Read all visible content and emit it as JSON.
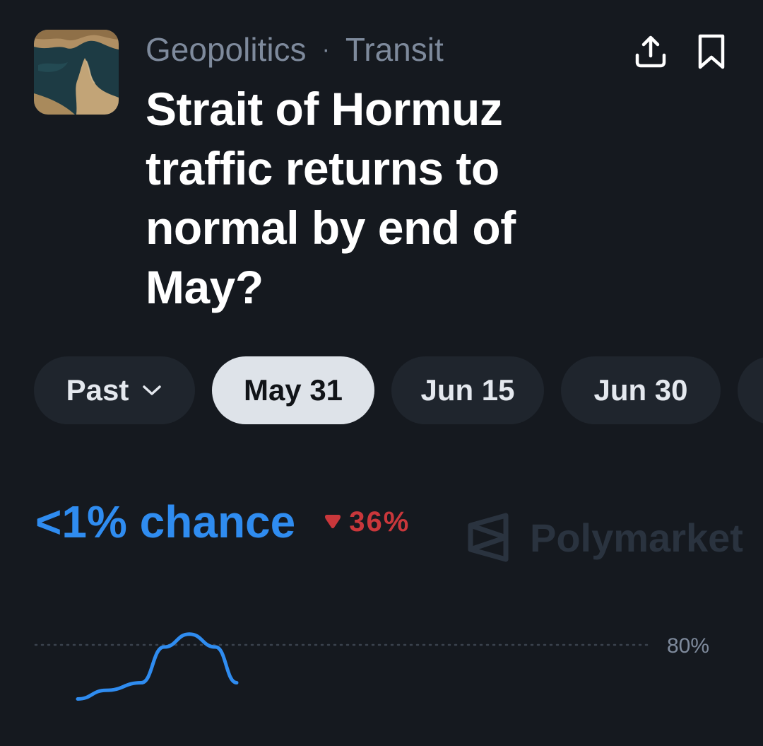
{
  "header": {
    "category": "Geopolitics",
    "separator": "·",
    "subcategory": "Transit",
    "title": "Strait of Hormuz traffic returns to normal by end of May?",
    "thumbnail_icon": "strait-map-thumbnail",
    "share_icon": "share-upload-icon",
    "bookmark_icon": "bookmark-icon"
  },
  "date_tabs": {
    "past_label": "Past",
    "items": [
      "May 31",
      "Jun 15",
      "Jun 30"
    ],
    "selected": "May 31"
  },
  "market": {
    "chance_text": "<1% chance",
    "change_text": "36%",
    "change_direction": "down",
    "watermark": "Polymarket"
  },
  "colors": {
    "background": "#15191f",
    "accent_blue": "#2f8cf0",
    "down_red": "#c9373b",
    "muted": "#7e8a9c"
  },
  "chart_data": {
    "type": "line",
    "ylabel": "",
    "y_tick_labels": [
      "80%"
    ],
    "gridline_values": [
      80
    ],
    "series": [
      {
        "values": [
          30,
          38,
          45,
          78,
          90,
          78,
          45
        ]
      }
    ]
  }
}
